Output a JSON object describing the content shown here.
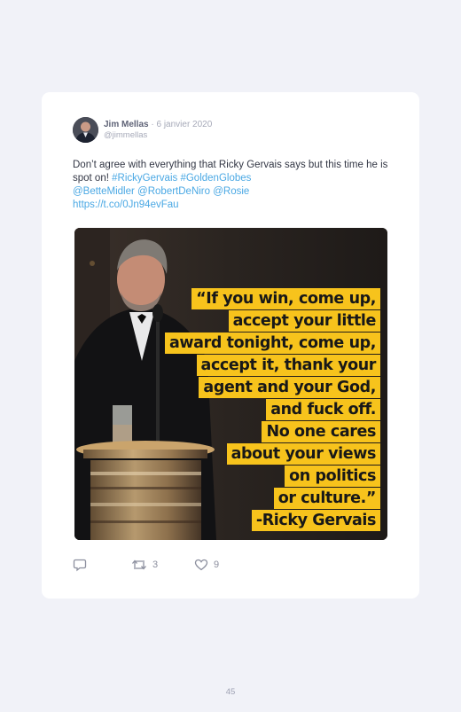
{
  "tweet": {
    "author_name": "Jim Mellas",
    "date": " · 6 janvier 2020",
    "handle": "@jimmellas",
    "text_plain": "Don’t agree with everything that Ricky Gervais says but this time he is spot on! ",
    "hashtag_1": "#RickyGervais",
    "hashtag_2": "#GoldenGlobes",
    "mention_1": "@BetteMidler",
    "mention_2": "@RobertDeNiro",
    "mention_3": "@Rosie",
    "url": "https://t.co/0Jn94evFau"
  },
  "media": {
    "quote_lines": [
      "“If you win, come up,",
      "accept your little",
      "award tonight, come up,",
      "accept it, thank your",
      "agent and your God,",
      "and fuck off.",
      "No one cares",
      "about your views",
      "on politics",
      "or culture.”",
      "-Ricky Gervais"
    ],
    "highlight_color": "#f7c31c"
  },
  "actions": {
    "reply_icon": "reply-icon",
    "retweet_icon": "retweet-icon",
    "retweet_count": "3",
    "like_icon": "heart-icon",
    "like_count": "9"
  },
  "page": {
    "number": "45"
  },
  "colors": {
    "link": "#4aa8e4",
    "background": "#f1f2f8",
    "card": "#ffffff"
  }
}
